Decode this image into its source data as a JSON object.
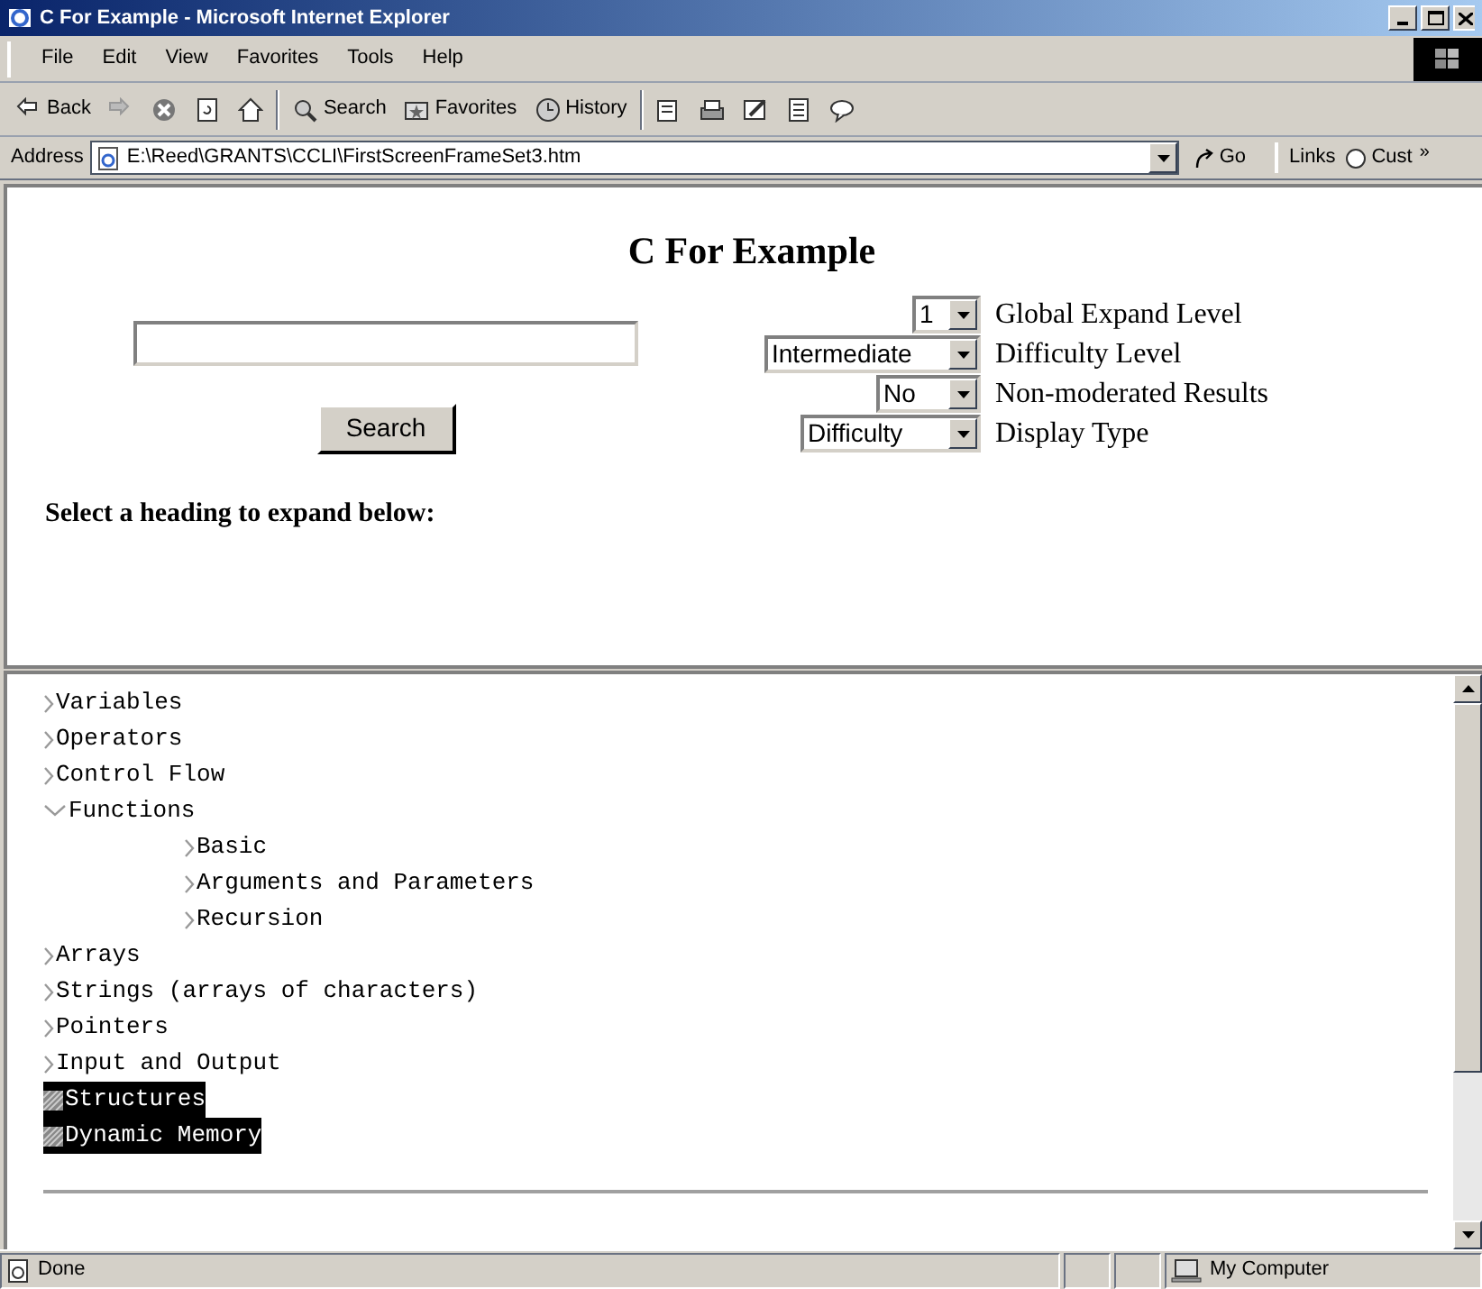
{
  "window": {
    "title": "C For Example - Microsoft Internet Explorer"
  },
  "menu": [
    "File",
    "Edit",
    "View",
    "Favorites",
    "Tools",
    "Help"
  ],
  "toolbar": [
    {
      "kind": "back",
      "label": "Back"
    },
    {
      "kind": "forward"
    },
    {
      "kind": "stop"
    },
    {
      "kind": "refresh"
    },
    {
      "kind": "home"
    },
    {
      "kind": "search",
      "label": "Search"
    },
    {
      "kind": "favorites",
      "label": "Favorites"
    },
    {
      "kind": "history",
      "label": "History"
    },
    {
      "kind": "mail"
    },
    {
      "kind": "print"
    },
    {
      "kind": "edit"
    },
    {
      "kind": "discuss"
    },
    {
      "kind": "messenger"
    }
  ],
  "address": {
    "label": "Address",
    "value": "E:\\Reed\\GRANTS\\CCLI\\FirstScreenFrameSet3.htm",
    "go": "Go",
    "links": "Links",
    "link_item": "Cust",
    "more": "»"
  },
  "page": {
    "heading": "C For Example",
    "search_button": "Search",
    "options": [
      {
        "value": "1",
        "label": "Global Expand Level"
      },
      {
        "value": "Intermediate",
        "label": "Difficulty Level"
      },
      {
        "value": "No",
        "label": "Non-moderated Results"
      },
      {
        "value": "Difficulty",
        "label": "Display Type"
      }
    ],
    "prompt": "Select a heading to expand below:"
  },
  "tree": [
    {
      "label": "Variables",
      "kind": "branch",
      "expanded": false,
      "selected": false
    },
    {
      "label": "Operators",
      "kind": "branch",
      "expanded": false,
      "selected": false
    },
    {
      "label": "Control Flow",
      "kind": "branch",
      "expanded": false,
      "selected": false
    },
    {
      "label": "Functions",
      "kind": "branch",
      "expanded": true,
      "selected": false,
      "children": [
        {
          "label": "Basic",
          "kind": "branch",
          "expanded": false,
          "selected": false
        },
        {
          "label": "Arguments and Parameters",
          "kind": "branch",
          "expanded": false,
          "selected": false
        },
        {
          "label": "Recursion",
          "kind": "branch",
          "expanded": false,
          "selected": false
        }
      ]
    },
    {
      "label": "Arrays",
      "kind": "branch",
      "expanded": false,
      "selected": false
    },
    {
      "label": "Strings (arrays of characters)",
      "kind": "branch",
      "expanded": false,
      "selected": false
    },
    {
      "label": "Pointers",
      "kind": "branch",
      "expanded": false,
      "selected": false
    },
    {
      "label": "Input and Output",
      "kind": "branch",
      "expanded": false,
      "selected": false
    },
    {
      "label": "Structures",
      "kind": "leaf",
      "selected": true
    },
    {
      "label": "Dynamic Memory",
      "kind": "leaf",
      "selected": true
    }
  ],
  "status_bar": {
    "text": "Done",
    "zone": "My Computer"
  }
}
